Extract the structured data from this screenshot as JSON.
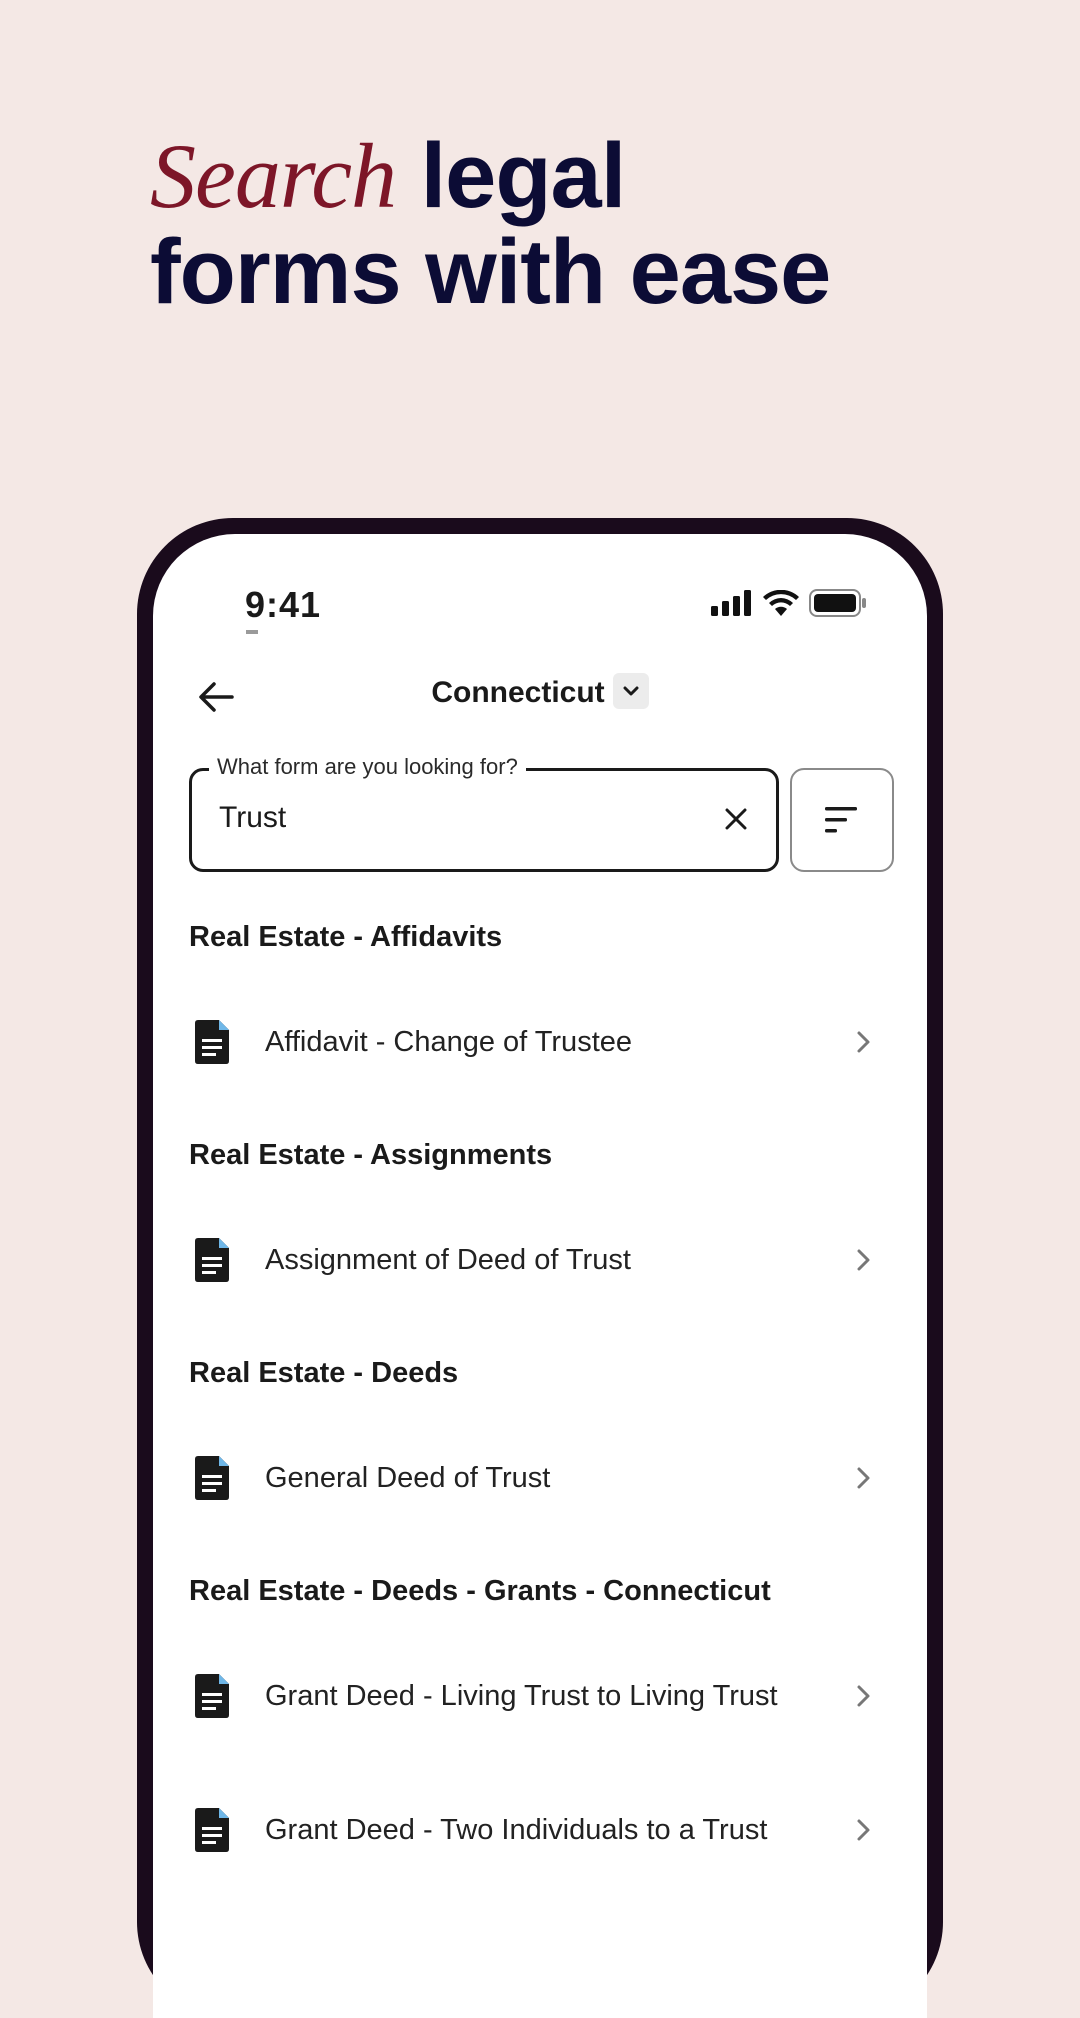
{
  "headline": {
    "accent": "Search",
    "rest_line1": " legal",
    "line2": "forms with ease"
  },
  "status_bar": {
    "time": "9:41"
  },
  "nav": {
    "title": "Connecticut"
  },
  "search": {
    "label": "What form are you looking for?",
    "value": "Trust"
  },
  "sections": [
    {
      "title": "Real Estate - Affidavits",
      "items": [
        "Affidavit - Change of Trustee"
      ]
    },
    {
      "title": "Real Estate - Assignments",
      "items": [
        "Assignment of Deed of Trust"
      ]
    },
    {
      "title": "Real Estate - Deeds",
      "items": [
        "General Deed of Trust"
      ]
    },
    {
      "title": "Real Estate - Deeds - Grants - Connecticut",
      "items": [
        "Grant Deed - Living Trust to Living Trust",
        "Grant Deed - Two Individuals to a Trust"
      ]
    }
  ]
}
